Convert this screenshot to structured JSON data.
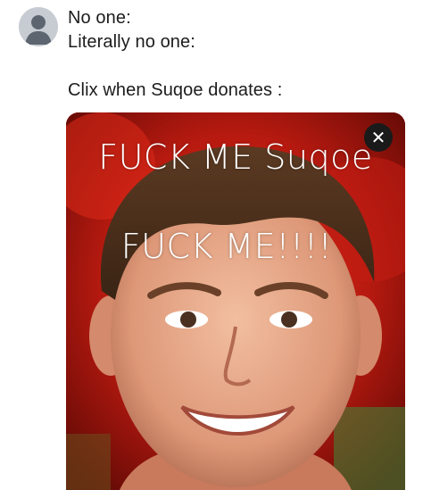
{
  "tweet": {
    "lines": [
      "No one:",
      "Literally no one:",
      "",
      "Clix when Suqoe donates :"
    ]
  },
  "media": {
    "caption_line_1": "FUCK ME Suqoe",
    "caption_line_2": "FUCK ME!!!!",
    "close_glyph": "✕",
    "close_icon": "close-icon",
    "background_color": "#a3150f"
  },
  "avatar_icon": "default-avatar-icon"
}
